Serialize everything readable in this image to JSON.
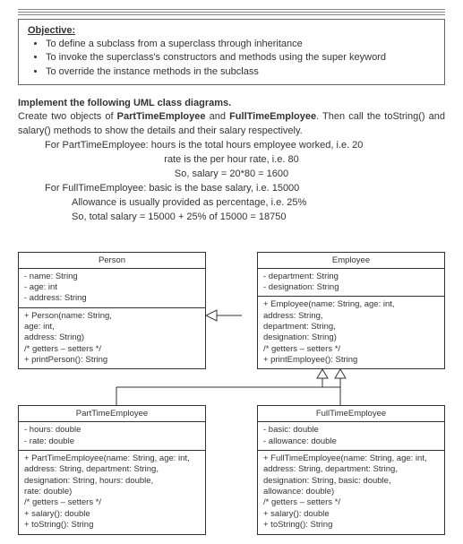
{
  "header": {
    "objective_label": "Objective:",
    "bullets": [
      "To define a subclass from a superclass through inheritance",
      "To invoke the superclass's constructors and methods using the super keyword",
      "To override the instance methods in the subclass"
    ]
  },
  "instructions": {
    "title": "Implement the following UML class diagrams.",
    "line1_a": "Create two objects of ",
    "line1_b": "PartTimeEmployee",
    "line1_c": " and ",
    "line1_d": "FullTimeEmployee",
    "line1_e": ". Then call the toString() and salary() methods to show the details and their salary respectively.",
    "pt1": "For PartTimeEmployee: hours is the total hours employee worked, i.e. 20",
    "pt2": "rate is the per hour rate, i.e. 80",
    "pt3": "So, salary = 20*80 = 1600",
    "ft1": "For FullTimeEmployee: basic is the base salary, i.e. 15000",
    "ft2": "Allowance is usually provided as percentage, i.e. 25%",
    "ft3": "So, total salary = 15000 + 25% of 15000 = 18750"
  },
  "uml": {
    "person": {
      "title": "Person",
      "attrs": "- name: String\n- age: int\n- address: String",
      "ops": "+ Person(name: String,\n        age: int,\n        address: String)\n/* getters – setters */\n+ printPerson(): String"
    },
    "employee": {
      "title": "Employee",
      "attrs": "- department: String\n- designation: String",
      "ops": "+ Employee(name: String, age: int,\n        address: String,\n        department: String,\n        designation: String)\n/* getters – setters */\n+ printEmployee(): String"
    },
    "parttime": {
      "title": "PartTimeEmployee",
      "attrs": "- hours: double\n- rate: double",
      "ops": "+ PartTimeEmployee(name: String, age: int,\n        address: String, department: String,\n        designation: String, hours: double,\n        rate: double)\n/* getters – setters */\n+ salary(): double\n+ toString(): String"
    },
    "fulltime": {
      "title": "FullTimeEmployee",
      "attrs": "- basic: double\n- allowance: double",
      "ops": "+ FullTimeEmployee(name: String, age: int,\n        address: String, department: String,\n        designation: String, basic: double,\n        allowance: double)\n/* getters – setters */\n+ salary(): double\n+ toString(): String"
    }
  }
}
